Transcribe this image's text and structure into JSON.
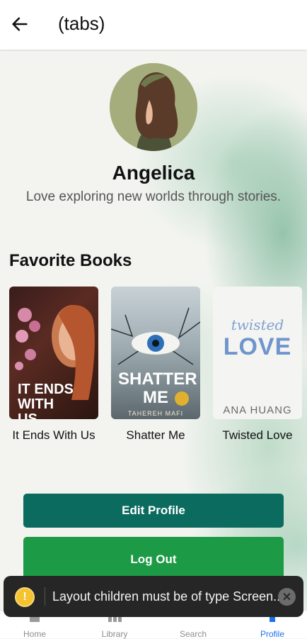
{
  "header": {
    "title": "(tabs)",
    "back_icon": "arrow-left-icon"
  },
  "profile": {
    "name": "Angelica",
    "bio": "Love exploring new worlds through stories."
  },
  "favorites": {
    "title": "Favorite Books",
    "books": [
      {
        "title": "It Ends With Us",
        "cover_text": "IT ENDS WITH US"
      },
      {
        "title": "Shatter Me",
        "cover_text": "SHATTER ME",
        "cover_author": "TAHEREH MAFI"
      },
      {
        "title": "Twisted Love",
        "cover_text": "LOVE",
        "cover_script": "twisted",
        "cover_author": "ANA HUANG"
      }
    ]
  },
  "actions": {
    "edit_label": "Edit Profile",
    "logout_label": "Log Out",
    "edit_color": "#0b6b5f",
    "logout_color": "#1d9a45"
  },
  "toast": {
    "message": "Layout children must be of type Screen...",
    "icon": "warning-icon",
    "icon_text": "!",
    "close_text": "✕"
  },
  "tabs": [
    {
      "label": "Home",
      "icon": "home-icon",
      "active": false
    },
    {
      "label": "Library",
      "icon": "library-icon",
      "active": false
    },
    {
      "label": "Search",
      "icon": "search-icon",
      "active": false
    },
    {
      "label": "Profile",
      "icon": "profile-icon",
      "active": true
    }
  ],
  "colors": {
    "accent": "#1a73e8"
  }
}
